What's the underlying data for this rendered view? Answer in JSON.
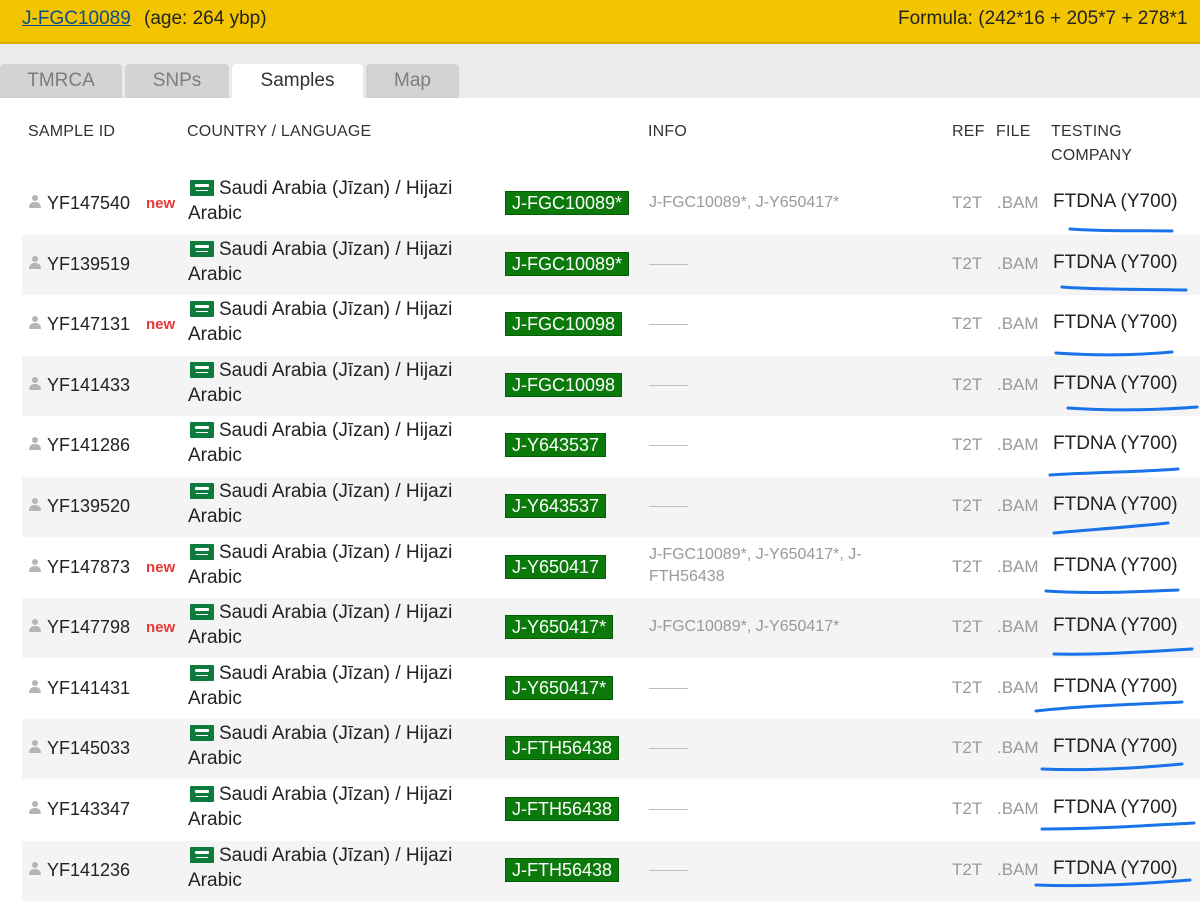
{
  "topbar": {
    "haplogroup": "J-FGC10089",
    "age": "(age: 264 ybp)",
    "formula": "Formula: (242*16 + 205*7 + 278*1"
  },
  "tabs": [
    {
      "label": "TMRCA",
      "active": false
    },
    {
      "label": "SNPs",
      "active": false
    },
    {
      "label": "Samples",
      "active": true
    },
    {
      "label": "Map",
      "active": false
    }
  ],
  "table": {
    "headers": {
      "sample_id": "SAMPLE ID",
      "country": "COUNTRY / LANGUAGE",
      "info": "INFO",
      "ref": "REF",
      "file": "FILE",
      "company_line1": "TESTING",
      "company_line2": "COMPANY"
    },
    "rows": [
      {
        "id": "YF147540",
        "new": "new",
        "country": "Saudi Arabia (Jīzan) / Hijazi",
        "language": "Arabic",
        "snp": "J-FGC10089*",
        "info": "J-FGC10089*, J-Y650417*",
        "ref": "T2T",
        "file": ".BAM",
        "company": "FTDNA (Y700)"
      },
      {
        "id": "YF139519",
        "new": "",
        "country": "Saudi Arabia (Jīzan) / Hijazi",
        "language": "Arabic",
        "snp": "J-FGC10089*",
        "info": "",
        "ref": "T2T",
        "file": ".BAM",
        "company": "FTDNA (Y700)"
      },
      {
        "id": "YF147131",
        "new": "new",
        "country": "Saudi Arabia (Jīzan) / Hijazi",
        "language": "Arabic",
        "snp": "J-FGC10098",
        "info": "",
        "ref": "T2T",
        "file": ".BAM",
        "company": "FTDNA (Y700)"
      },
      {
        "id": "YF141433",
        "new": "",
        "country": "Saudi Arabia (Jīzan) / Hijazi",
        "language": "Arabic",
        "snp": "J-FGC10098",
        "info": "",
        "ref": "T2T",
        "file": ".BAM",
        "company": "FTDNA (Y700)"
      },
      {
        "id": "YF141286",
        "new": "",
        "country": "Saudi Arabia (Jīzan) / Hijazi",
        "language": "Arabic",
        "snp": "J-Y643537",
        "info": "",
        "ref": "T2T",
        "file": ".BAM",
        "company": "FTDNA (Y700)"
      },
      {
        "id": "YF139520",
        "new": "",
        "country": "Saudi Arabia (Jīzan) / Hijazi",
        "language": "Arabic",
        "snp": "J-Y643537",
        "info": "",
        "ref": "T2T",
        "file": ".BAM",
        "company": "FTDNA (Y700)"
      },
      {
        "id": "YF147873",
        "new": "new",
        "country": "Saudi Arabia (Jīzan) / Hijazi",
        "language": "Arabic",
        "snp": "J-Y650417",
        "info": "J-FGC10089*, J-Y650417*, J-FTH56438",
        "ref": "T2T",
        "file": ".BAM",
        "company": "FTDNA (Y700)"
      },
      {
        "id": "YF147798",
        "new": "new",
        "country": "Saudi Arabia (Jīzan) / Hijazi",
        "language": "Arabic",
        "snp": "J-Y650417*",
        "info": "J-FGC10089*, J-Y650417*",
        "ref": "T2T",
        "file": ".BAM",
        "company": "FTDNA (Y700)"
      },
      {
        "id": "YF141431",
        "new": "",
        "country": "Saudi Arabia (Jīzan) / Hijazi",
        "language": "Arabic",
        "snp": "J-Y650417*",
        "info": "",
        "ref": "T2T",
        "file": ".BAM",
        "company": "FTDNA (Y700)"
      },
      {
        "id": "YF145033",
        "new": "",
        "country": "Saudi Arabia (Jīzan) / Hijazi",
        "language": "Arabic",
        "snp": "J-FTH56438",
        "info": "",
        "ref": "T2T",
        "file": ".BAM",
        "company": "FTDNA (Y700)"
      },
      {
        "id": "YF143347",
        "new": "",
        "country": "Saudi Arabia (Jīzan) / Hijazi",
        "language": "Arabic",
        "snp": "J-FTH56438",
        "info": "",
        "ref": "T2T",
        "file": ".BAM",
        "company": "FTDNA (Y700)"
      },
      {
        "id": "YF141236",
        "new": "",
        "country": "Saudi Arabia (Jīzan) / Hijazi",
        "language": "Arabic",
        "snp": "J-FTH56438",
        "info": "",
        "ref": "T2T",
        "file": ".BAM",
        "company": "FTDNA (Y700)"
      }
    ]
  },
  "colors": {
    "topbar_bg": "#f3c400",
    "snp_badge_bg": "#0b7a0b",
    "new_tag": "#e53935",
    "annotation_underline": "#1a73e8"
  },
  "icons": {
    "sample": "person-icon",
    "flag": "saudi-arabia-flag-icon"
  }
}
